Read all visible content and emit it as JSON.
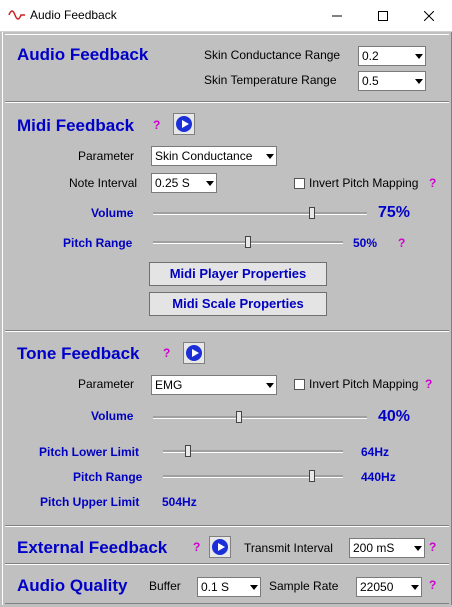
{
  "window": {
    "title": "Audio Feedback"
  },
  "audio_feedback": {
    "header": "Audio Feedback",
    "skin_conductance_range_label": "Skin Conductance Range",
    "skin_conductance_range_value": "0.2",
    "skin_temperature_range_label": "Skin Temperature Range",
    "skin_temperature_range_value": "0.5"
  },
  "midi_feedback": {
    "header": "Midi Feedback",
    "help": "?",
    "parameter_label": "Parameter",
    "parameter_value": "Skin Conductance",
    "note_interval_label": "Note Interval",
    "note_interval_value": "0.25 S",
    "invert_pitch_label": "Invert Pitch Mapping",
    "invert_help": "?",
    "volume_label": "Volume",
    "volume_value": "75%",
    "volume_level": 0.75,
    "pitch_range_label": "Pitch Range",
    "pitch_range_value": "50%",
    "pitch_range_level": 0.5,
    "pitch_help": "?",
    "player_button": "Midi Player Properties",
    "scale_button": "Midi Scale Properties"
  },
  "tone_feedback": {
    "header": "Tone Feedback",
    "help": "?",
    "parameter_label": "Parameter",
    "parameter_value": "EMG",
    "invert_pitch_label": "Invert Pitch Mapping",
    "invert_help": "?",
    "volume_label": "Volume",
    "volume_value": "40%",
    "volume_level": 0.4,
    "pitch_lower_label": "Pitch Lower Limit",
    "pitch_lower_value": "64Hz",
    "pitch_range_label": "Pitch Range",
    "pitch_range_value": "440Hz",
    "pitch_upper_label": "Pitch Upper Limit",
    "pitch_upper_value": "504Hz"
  },
  "external_feedback": {
    "header": "External Feedback",
    "help": "?",
    "transmit_interval_label": "Transmit Interval",
    "transmit_interval_value": "200 mS",
    "transmit_help": "?"
  },
  "audio_quality": {
    "header": "Audio Quality",
    "buffer_label": "Buffer",
    "buffer_value": "0.1 S",
    "sample_rate_label": "Sample Rate",
    "sample_rate_value": "22050",
    "help": "?"
  },
  "colors": {
    "header_blue": "#0000c8",
    "help_magenta": "#d000d0",
    "panel_gray": "#c0c0c0"
  }
}
